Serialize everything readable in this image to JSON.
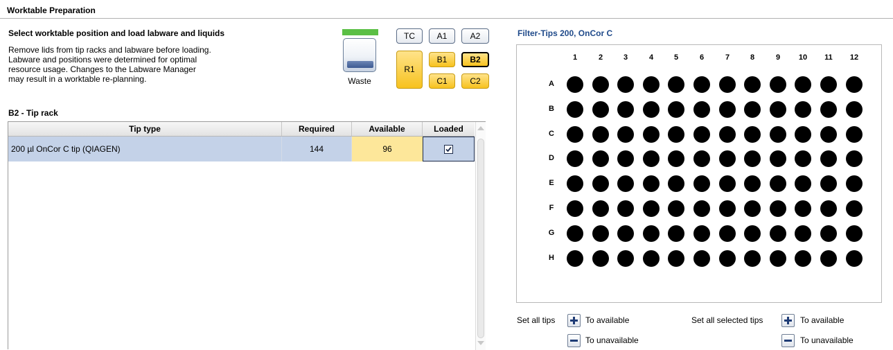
{
  "header": {
    "title": "Worktable Preparation"
  },
  "instructions": {
    "title": "Select worktable position and load labware and liquids",
    "lines": [
      "Remove lids from tip racks and labware before loading.",
      "Labware and positions were determined for optimal",
      "resource usage. Changes to the Labware Manager",
      "may result in a worktable re-planning."
    ]
  },
  "worktable": {
    "waste_label": "Waste",
    "positions": {
      "TC": "TC",
      "A1": "A1",
      "A2": "A2",
      "R1": "R1",
      "B1": "B1",
      "B2": "B2",
      "C1": "C1",
      "C2": "C2"
    },
    "selected": "B2",
    "colors": {
      "waste_bar": "#5bbf45",
      "loaded": "#f7c21e",
      "neutral": "#e6eaf0"
    }
  },
  "tip_table": {
    "title": "B2 - Tip rack",
    "columns": [
      "Tip type",
      "Required",
      "Available",
      "Loaded"
    ],
    "rows": [
      {
        "tip_type": "200 µl OnCor C tip (QIAGEN)",
        "required": "144",
        "available": "96",
        "loaded": true
      }
    ]
  },
  "rack_view": {
    "name": "Filter-Tips 200, OnCor C",
    "columns": [
      "1",
      "2",
      "3",
      "4",
      "5",
      "6",
      "7",
      "8",
      "9",
      "10",
      "11",
      "12"
    ],
    "rows": [
      "A",
      "B",
      "C",
      "D",
      "E",
      "F",
      "G",
      "H"
    ],
    "tip_state": "all-available"
  },
  "controls": {
    "set_all_label": "Set all tips",
    "set_selected_label": "Set all selected tips",
    "to_available": "To available",
    "to_unavailable": "To unavailable",
    "icons": {
      "plus": "plus-icon",
      "minus": "minus-icon"
    }
  }
}
